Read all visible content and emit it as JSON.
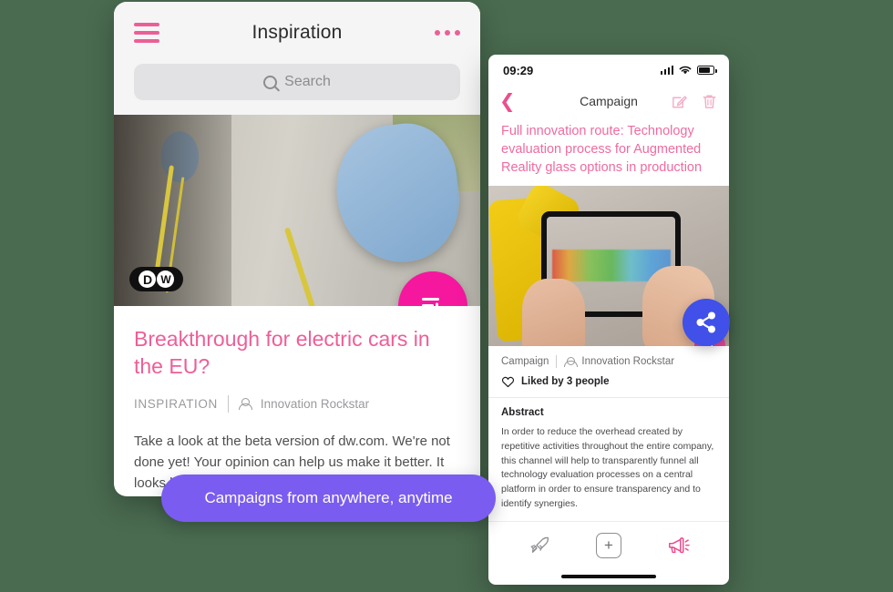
{
  "background_color": "#4a6b50",
  "accent_pink": "#ee5e97",
  "accent_magenta": "#f5189e",
  "accent_blue": "#4050e8",
  "accent_purple": "#7a5cf0",
  "left_phone": {
    "header": {
      "title": "Inspiration",
      "menu_icon": "hamburger-menu-icon",
      "more_icon": "more-options-icon"
    },
    "search": {
      "placeholder": "Search",
      "icon": "search-icon"
    },
    "hero": {
      "logo_d": "D",
      "logo_w": "W",
      "logo_alt": "DW",
      "fab_icon": "add-to-list-icon"
    },
    "article": {
      "headline": "Breakthrough for electric cars in the EU?",
      "category": "INSPIRATION",
      "author": "Innovation Rockstar",
      "author_icon": "person-icon",
      "body": "Take a look at the beta version of dw.com. We're not done yet! Your opinion can help us make it better. It looks like the EU is witnessing a big victory for e-…"
    }
  },
  "right_phone": {
    "status_bar": {
      "time": "09:29",
      "signal_icon": "cellular-signal-icon",
      "wifi_icon": "wifi-icon",
      "battery_icon": "battery-icon"
    },
    "navbar": {
      "back_icon": "chevron-left-icon",
      "title": "Campaign",
      "edit_icon": "edit-pencil-icon",
      "delete_icon": "trash-icon"
    },
    "campaign": {
      "title": "Full innovation route: Technology evaluation process for Augmented Reality glass options in production",
      "image_fab_icon": "add-to-list-icon",
      "category": "Campaign",
      "author": "Innovation Rockstar",
      "author_icon": "person-icon",
      "likes_icon": "heart-icon",
      "likes_text": "Liked by 3 people",
      "abstract_heading": "Abstract",
      "abstract_body": "In order to reduce the overhead created by repetitive activities throughout the entire company, this channel will help to transparently funnel all technology evaluation processes on a central platform in order to ensure transparency and to identify synergies."
    },
    "tabbar": {
      "rocket_icon": "rocket-icon",
      "add_icon": "plus-icon",
      "add_label": "+",
      "megaphone_icon": "megaphone-icon"
    }
  },
  "share_button": {
    "icon": "share-icon"
  },
  "callout": {
    "text": "Campaigns from anywhere, anytime"
  }
}
